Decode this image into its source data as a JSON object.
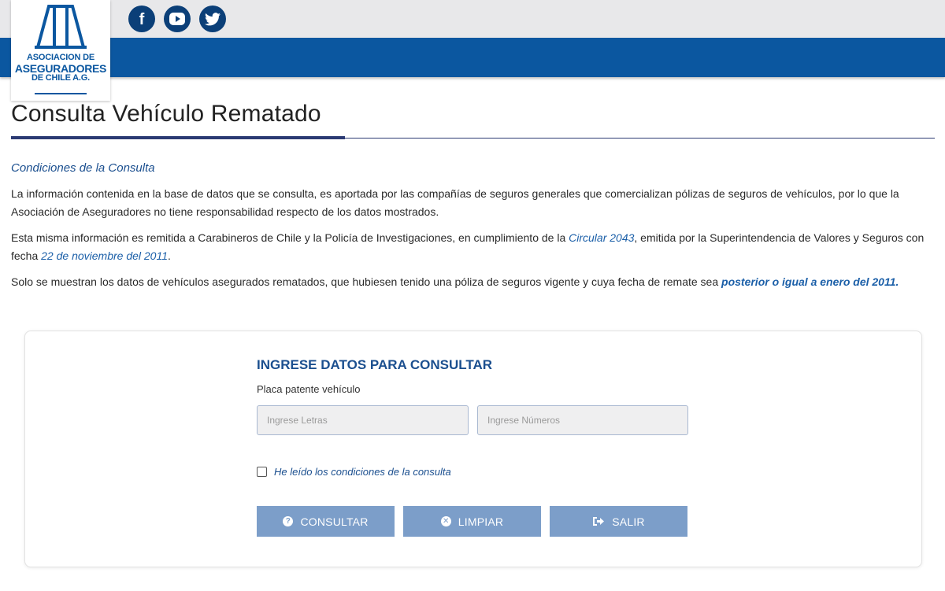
{
  "header": {
    "logo": {
      "line1": "ASOCIACION DE",
      "line2": "ASEGURADORES",
      "line3": "DE CHILE A.G."
    },
    "social": [
      {
        "icon": "facebook-icon"
      },
      {
        "icon": "youtube-icon"
      },
      {
        "icon": "twitter-icon"
      }
    ],
    "colors": {
      "brand_blue": "#0b57a0",
      "top_bar": "#e8e8ea",
      "social_bg": "#0b3f78"
    }
  },
  "page": {
    "title": "Consulta Vehículo Rematado",
    "conditions_heading": "Condiciones de la Consulta",
    "para1": "La información contenida en la base de datos que se consulta, es aportada por las compañías de seguros generales que comercializan pólizas de seguros de vehículos, por lo que la Asociación de Aseguradores no tiene responsabilidad respecto de los datos mostrados.",
    "para2_a": "Esta misma información es remitida a Carabineros de Chile y la Policía de Investigaciones, en cumplimiento de la ",
    "para2_link1": "Circular 2043",
    "para2_b": ", emitida por la Superintendencia de Valores y Seguros con fecha ",
    "para2_link2": "22 de noviembre del 2011",
    "para2_c": ".",
    "para3_a": "Solo se muestran los datos de vehículos asegurados rematados, que hubiesen tenido una póliza de seguros vigente y cuya fecha de remate sea ",
    "para3_link": "posterior o igual a enero del 2011",
    "para3_c": "."
  },
  "form": {
    "heading": "INGRESE DATOS PARA CONSULTAR",
    "plate_label": "Placa patente vehículo",
    "letters_placeholder": "Ingrese Letras",
    "numbers_placeholder": "Ingrese Números",
    "letters_value": "",
    "numbers_value": "",
    "checkbox_label": "He leído los condiciones de la consulta",
    "checkbox_checked": false,
    "buttons": {
      "consultar": "CONSULTAR",
      "limpiar": "LIMPIAR",
      "salir": "SALIR"
    },
    "colors": {
      "button_bg": "#7c9ec9",
      "heading": "#1b4f8f"
    }
  }
}
